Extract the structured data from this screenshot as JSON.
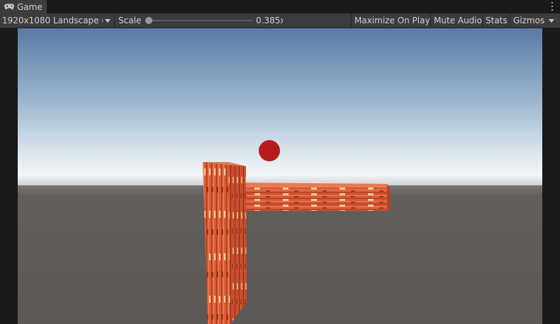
{
  "tab": {
    "label": "Game",
    "icon": "gamepad-icon"
  },
  "toolbar": {
    "resolution": "1920x1080 Landscape (1",
    "scale_label": "Scale",
    "scale_value": "0.385",
    "scale_value_suffix": "x",
    "maximize_label": "Maximize On Play",
    "mute_label": "Mute Audio",
    "stats_label": "Stats",
    "gizmos_label": "Gizmos"
  },
  "colors": {
    "panel": "#3c3c3c",
    "background": "#191919",
    "sky_top": "#5a7ba6",
    "horizon": "#f4f6f8",
    "ground": "#5e5a57",
    "ball": "#b51c1c",
    "brick": "#d95a36"
  }
}
